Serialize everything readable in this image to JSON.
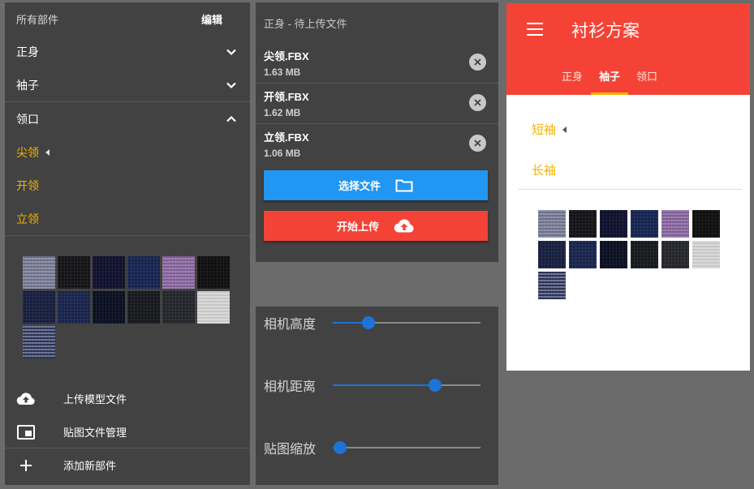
{
  "left_panel": {
    "header": "所有部件",
    "edit": "编辑",
    "categories": [
      {
        "label": "正身",
        "expanded": false,
        "icon": "chevron-down-icon"
      },
      {
        "label": "袖子",
        "expanded": false,
        "icon": "chevron-down-icon"
      },
      {
        "label": "领口",
        "expanded": true,
        "icon": "chevron-up-icon"
      }
    ],
    "subitems": [
      {
        "label": "尖领",
        "selected": true
      },
      {
        "label": "开领",
        "selected": false
      },
      {
        "label": "立领",
        "selected": false
      }
    ],
    "actions": [
      {
        "label": "上传模型文件",
        "icon": "cloud-upload-icon"
      },
      {
        "label": "贴图文件管理",
        "icon": "picture-in-picture-icon"
      },
      {
        "label": "添加新部件",
        "icon": "plus-icon"
      }
    ]
  },
  "swatches": [
    {
      "name": "grey-plaid",
      "colors": [
        "#8d90a8",
        "#6b6e86"
      ]
    },
    {
      "name": "black",
      "colors": [
        "#1c1c1e",
        "#121214"
      ]
    },
    {
      "name": "dark-navy",
      "colors": [
        "#151634",
        "#0f102a"
      ]
    },
    {
      "name": "navy-check",
      "colors": [
        "#1c2c5c",
        "#15224a"
      ]
    },
    {
      "name": "purple-plaid",
      "colors": [
        "#9b7bb0",
        "#7d5c92"
      ]
    },
    {
      "name": "black-2",
      "colors": [
        "#151515",
        "#0e0e0e"
      ]
    },
    {
      "name": "navy",
      "colors": [
        "#1d2648",
        "#161d3a"
      ]
    },
    {
      "name": "navy-stripe",
      "colors": [
        "#202c55",
        "#172247"
      ]
    },
    {
      "name": "midnight",
      "colors": [
        "#0f1528",
        "#0a0f1f"
      ]
    },
    {
      "name": "black-stripe",
      "colors": [
        "#1e1f24",
        "#16171b"
      ]
    },
    {
      "name": "charcoal",
      "colors": [
        "#2c2d33",
        "#232429"
      ]
    },
    {
      "name": "white-stripe",
      "colors": [
        "#d9d9d9",
        "#c6c6c6"
      ]
    },
    {
      "name": "navy-grid",
      "colors": [
        "#2a3150",
        "#6c7394"
      ]
    }
  ],
  "upload_panel": {
    "title": "正身 - 待上传文件",
    "files": [
      {
        "name": "尖领.FBX",
        "size": "1.63 MB"
      },
      {
        "name": "开领.FBX",
        "size": "1.62 MB"
      },
      {
        "name": "立领.FBX",
        "size": "1.06 MB"
      }
    ],
    "choose_label": "选择文件",
    "upload_label": "开始上传",
    "choose_color": "#2196f3",
    "upload_color": "#f44336"
  },
  "camera_panel": {
    "sliders": [
      {
        "label": "相机高度",
        "value": 0.24
      },
      {
        "label": "相机距离",
        "value": 0.69
      },
      {
        "label": "贴图缩放",
        "value": 0.05
      }
    ]
  },
  "mobile": {
    "title": "衬衫方案",
    "tabs": [
      "正身",
      "袖子",
      "领口"
    ],
    "active_tab": 1,
    "items": [
      {
        "label": "短袖",
        "selected": true
      },
      {
        "label": "长袖",
        "selected": false
      }
    ],
    "bar_color": "#f44336",
    "accent": "#f5b301"
  }
}
